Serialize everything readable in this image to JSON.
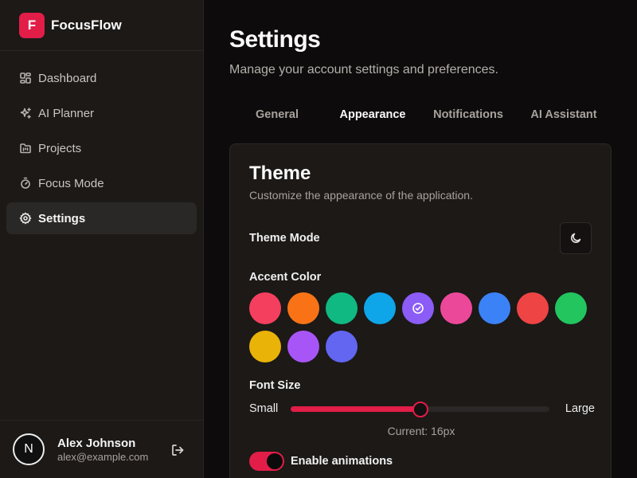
{
  "brand": {
    "logo_letter": "F",
    "name": "FocusFlow",
    "accent": "#e11d48"
  },
  "sidebar": {
    "items": [
      {
        "label": "Dashboard",
        "icon": "layout-dashboard-icon",
        "active": false
      },
      {
        "label": "AI Planner",
        "icon": "sparkles-icon",
        "active": false
      },
      {
        "label": "Projects",
        "icon": "folder-kanban-icon",
        "active": false
      },
      {
        "label": "Focus Mode",
        "icon": "timer-icon",
        "active": false
      },
      {
        "label": "Settings",
        "icon": "gear-icon",
        "active": true
      }
    ]
  },
  "user": {
    "avatar_letter": "N",
    "name": "Alex Johnson",
    "email": "alex@example.com",
    "logout_icon": "log-out-icon"
  },
  "page": {
    "title": "Settings",
    "subtitle": "Manage your account settings and preferences."
  },
  "tabs": [
    {
      "label": "General",
      "active": false
    },
    {
      "label": "Appearance",
      "active": true
    },
    {
      "label": "Notifications",
      "active": false
    },
    {
      "label": "AI Assistant",
      "active": false
    }
  ],
  "theme": {
    "title": "Theme",
    "subtitle": "Customize the appearance of the application.",
    "mode_label": "Theme Mode",
    "mode_icon": "moon-icon",
    "accent_label": "Accent Color",
    "accent_colors": [
      "#f43f5e",
      "#f97316",
      "#10b981",
      "#0ea5e9",
      "#8b5cf6",
      "#ec4899",
      "#3b82f6",
      "#ef4444",
      "#22c55e",
      "#eab308",
      "#a855f7",
      "#6366f1"
    ],
    "accent_selected_index": 4,
    "font_size_label": "Font Size",
    "font_size_min_label": "Small",
    "font_size_max_label": "Large",
    "font_size_fraction": 0.5,
    "font_size_current": "Current: 16px",
    "animations_label": "Enable animations",
    "animations_enabled": true
  }
}
